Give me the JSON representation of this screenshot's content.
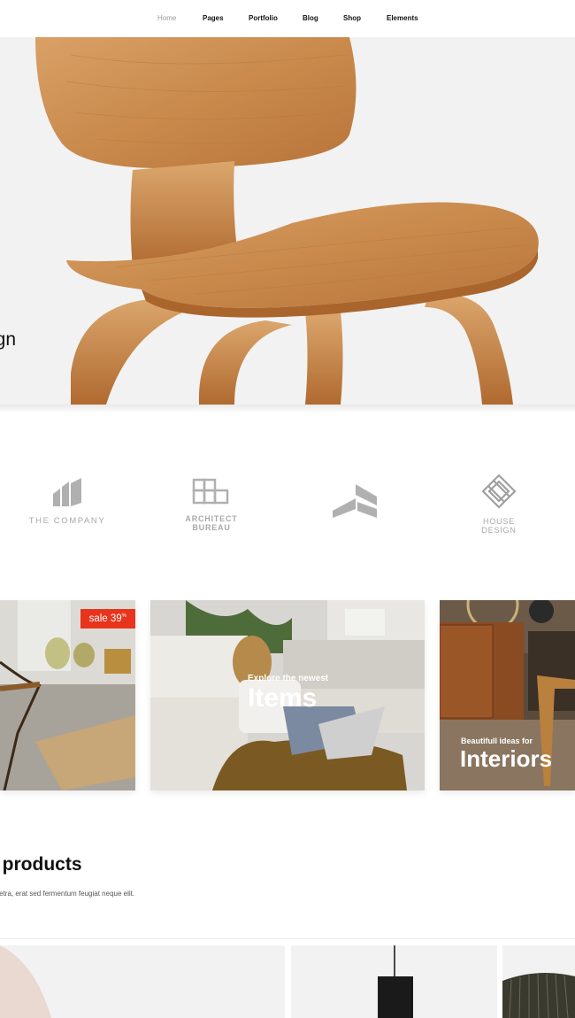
{
  "nav": {
    "items": [
      "Home",
      "Pages",
      "Portfolio",
      "Blog",
      "Shop",
      "Elements"
    ],
    "active": "Home"
  },
  "hero": {
    "title_fragment": "ign"
  },
  "logos": {
    "items": [
      "THE COMPANY",
      "ARCHITECT BUREAU",
      "",
      "HOUSE DESIGN"
    ]
  },
  "promos": {
    "sale": {
      "badge": "sale 39",
      "badge_sup": "%"
    },
    "items_card": {
      "sub": "Explore the newest",
      "main": "Items"
    },
    "interiors_card": {
      "sub": "Beautifull ideas for",
      "main": "Interiors"
    }
  },
  "section": {
    "title_fragment": "g products",
    "description": "aretra, erat sed fermentum feugiat neque elit."
  },
  "colors": {
    "accent": "#e8341c",
    "logo_gray": "#a9a9a9",
    "hero_bg": "#f2f2f2"
  }
}
